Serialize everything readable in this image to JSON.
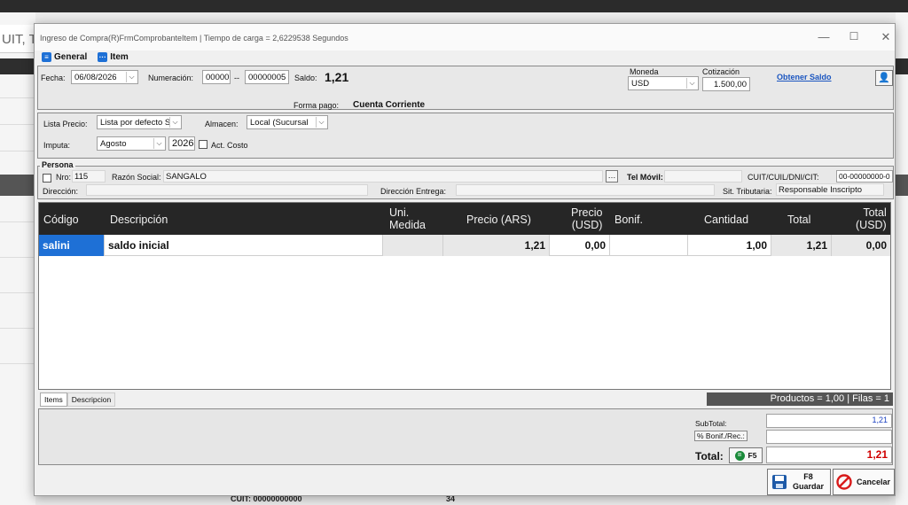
{
  "background": {
    "search_text": "UIT, T",
    "bottom_cuit": "CUIT: 00000000000",
    "bottom_number": "34"
  },
  "window": {
    "title": "Ingreso de Compra(R)FrmComprobanteItem | Tiempo de carga = 2,6229538 Segundos",
    "min_icon": "—",
    "max_icon": "☐",
    "close_icon": "✕"
  },
  "menu": {
    "general": "General",
    "item": "Item"
  },
  "header": {
    "fecha_label": "Fecha:",
    "fecha_value": "06/08/2026",
    "numeracion_label": "Numeración:",
    "num_prefix": "00000",
    "num_separator": "--",
    "num_value": "00000005",
    "saldo_label": "Saldo:",
    "saldo_value": "1,21",
    "moneda_label": "Moneda",
    "moneda_value": "USD",
    "cotizacion_label": "Cotización",
    "cotizacion_value": "1.500,00",
    "obtener_saldo": "Obtener Saldo",
    "forma_pago_label": "Forma pago:",
    "forma_pago_value": "Cuenta Corriente"
  },
  "options": {
    "lista_precio_label": "Lista Precio:",
    "lista_precio_value": "Lista por defecto SA",
    "almacen_label": "Almacen:",
    "almacen_value": "Local (Sucursal",
    "imputa_label": "Imputa:",
    "imputa_value": "Agosto",
    "year_value": "2026",
    "act_costo_label": "Act. Costo"
  },
  "persona": {
    "section_label": "Persona",
    "nro_label": "Nro:",
    "nro_value": "115",
    "razon_label": "Razón Social:",
    "razon_value": "SANGALO",
    "telmovil_label": "Tel Móvil:",
    "cuit_label": "CUIT/CUIL/DNI/CIT:",
    "cuit_value": "00-00000000-0",
    "direccion_label": "Dirección:",
    "direccion_entrega_label": "Dirección Entrega:",
    "sit_tributaria_label": "Sit. Tributaria:",
    "sit_tributaria_value": "Responsable Inscripto"
  },
  "grid": {
    "headers": [
      "Código",
      "Descripción",
      "Uni.\nMedida",
      "Precio (ARS)",
      "Precio\n(USD)",
      "Bonif.",
      "Cantidad",
      "Total",
      "Total\n(USD)"
    ],
    "rows": [
      [
        "salini",
        "saldo inicial",
        "",
        "1,21",
        "0,00",
        "",
        "1,00",
        "1,21",
        "0,00"
      ]
    ]
  },
  "tabs": {
    "items": "Items",
    "descripcion": "Descripcion"
  },
  "status": {
    "text": "Productos = 1,00 | Filas = 1"
  },
  "totals": {
    "subtotal_label": "SubTotal:",
    "subtotal_value": "1,21",
    "bonif_label": "% Bonif./Rec.:",
    "bonif_value": "",
    "total_label": "Total:",
    "f5_label": "F5",
    "total_value": "1,21"
  },
  "buttons": {
    "guardar_key": "F8",
    "guardar_label": "Guardar",
    "cancelar_label": "Cancelar"
  },
  "colors": {
    "accent": "#1e70d6",
    "grid_header": "#262626",
    "selected_cell": "#1e70d6",
    "total_red": "#d00000",
    "link": "#1a55c0"
  }
}
